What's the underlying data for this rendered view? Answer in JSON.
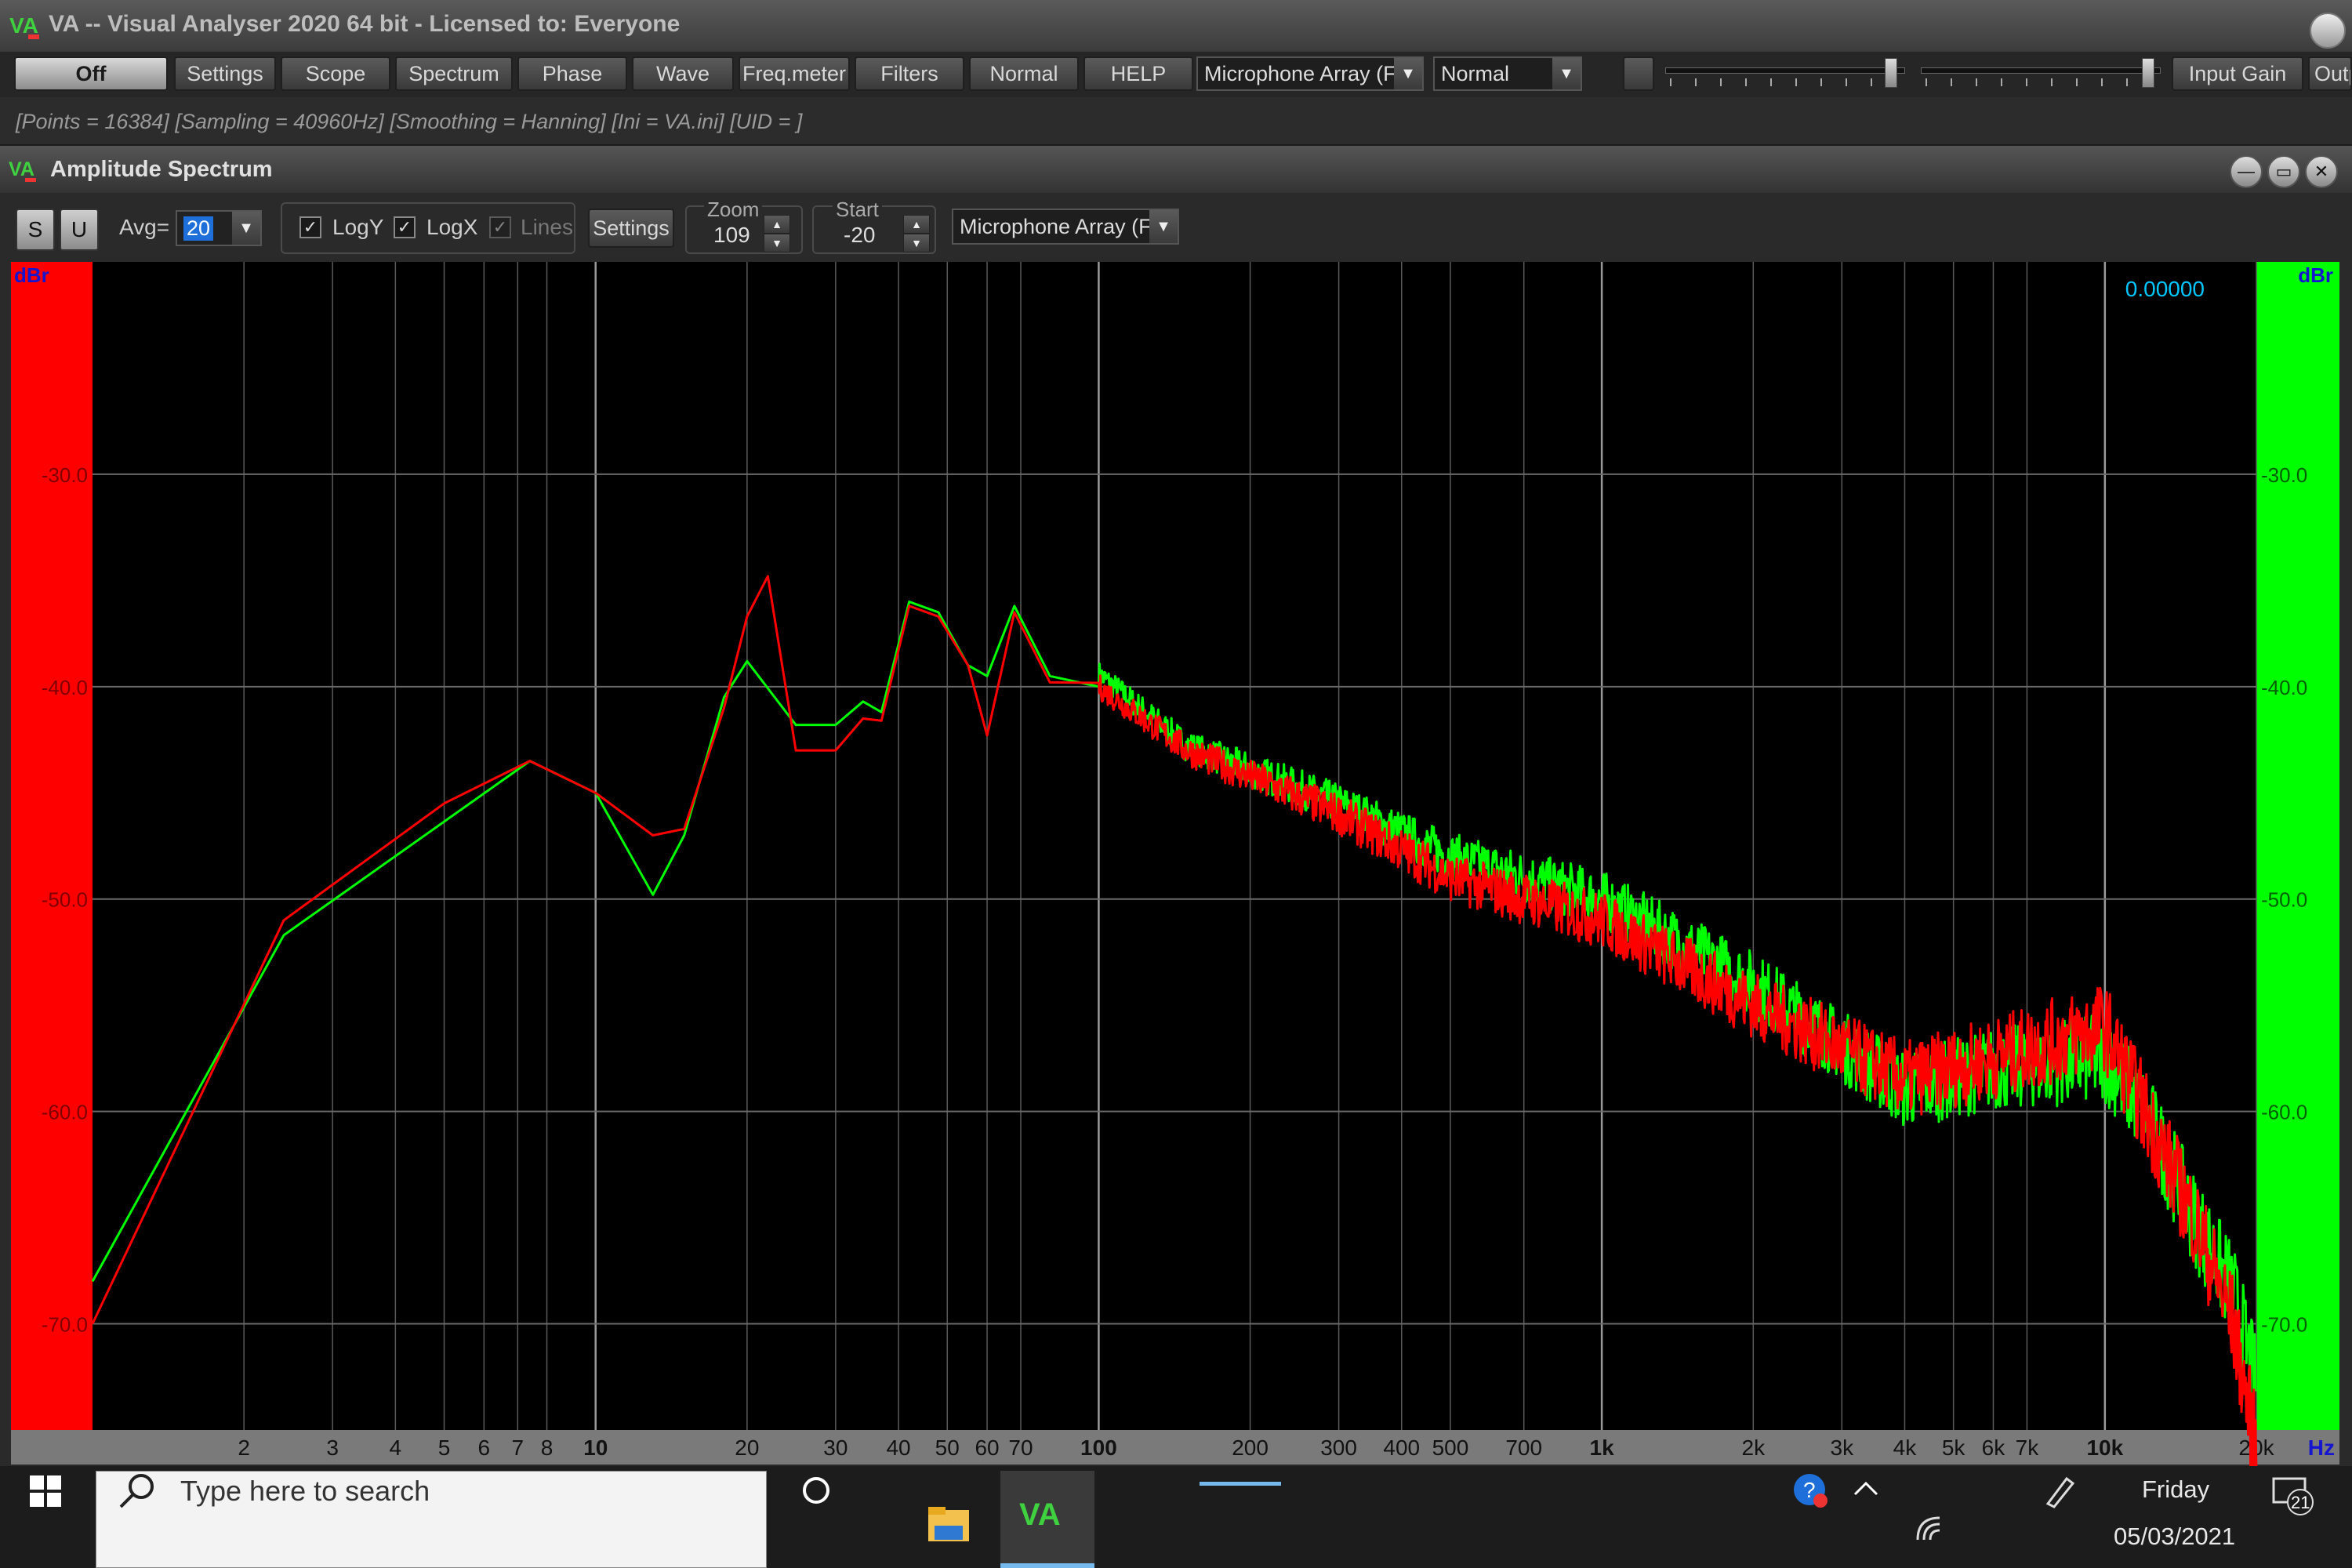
{
  "window": {
    "logo_text": "VA",
    "title": "VA -- Visual Analyser 2020 64 bit - Licensed to: Everyone"
  },
  "toolbar": {
    "buttons": [
      "Off",
      "Settings",
      "Scope",
      "Spectrum",
      "Phase",
      "Wave",
      "Freq.meter",
      "Filters",
      "Normal",
      "HELP"
    ],
    "device_select": "Microphone Array (F",
    "mode_select": "Normal",
    "input_gain_label": "Input Gain",
    "output_label": "Outp"
  },
  "status": "[Points = 16384]  [Sampling = 40960Hz]  [Smoothing = Hanning]  [Ini = VA.ini]  [UID = ]",
  "subwindow": {
    "title": "Amplitude Spectrum",
    "s_button": "S",
    "u_button": "U",
    "avg_label": "Avg=",
    "avg_value": "20",
    "logy_label": "LogY",
    "logx_label": "LogX",
    "lines_label": "Lines",
    "logy_checked": true,
    "logx_checked": true,
    "lines_checked": true,
    "settings_button": "Settings",
    "zoom_label": "Zoom",
    "zoom_value": "109",
    "start_label": "Start",
    "start_value": "-20",
    "device_select": "Microphone Array (F"
  },
  "chart_data": {
    "type": "line",
    "y_unit_left": "dBr",
    "y_unit_right": "dBr",
    "x_unit": "Hz",
    "readout": "0.00000",
    "xscale": "log",
    "xlim": [
      1,
      20000
    ],
    "ylim": [
      -75,
      -20
    ],
    "y_ticks": [
      "-30.0",
      "-40.0",
      "-50.0",
      "-60.0",
      "-70.0"
    ],
    "x_ticks": [
      "2",
      "3",
      "4",
      "5",
      "6",
      "7",
      "8",
      "10",
      "20",
      "30",
      "40",
      "50",
      "60",
      "70",
      "100",
      "200",
      "300",
      "400",
      "500",
      "700",
      "1k",
      "2k",
      "3k",
      "4k",
      "5k",
      "6k",
      "7k",
      "10k",
      "20k"
    ],
    "grid": true,
    "series": [
      {
        "color": "#00ff00",
        "x": [
          1,
          2.4,
          7.4,
          10,
          13,
          15,
          18,
          20,
          25,
          30,
          34,
          37,
          42,
          48,
          55,
          60,
          68,
          80,
          100,
          150,
          300,
          500,
          1000,
          2000,
          4000,
          6000,
          10000,
          12000,
          15000,
          18000,
          20000
        ],
        "y": [
          -68,
          -51.7,
          -43.5,
          -45,
          -49.8,
          -47,
          -40.5,
          -38.8,
          -41.8,
          -41.8,
          -40.7,
          -41.2,
          -36,
          -36.5,
          -39,
          -39.5,
          -36.2,
          -39.5,
          -39.4,
          -42.8,
          -45.5,
          -48,
          -50,
          -54,
          -59,
          -58,
          -57.5,
          -60,
          -65,
          -68.5,
          -73
        ]
      },
      {
        "color": "#ff0000",
        "x": [
          1,
          2.4,
          5,
          7.4,
          10,
          13,
          15,
          18,
          20,
          22,
          25,
          30,
          34,
          37,
          42,
          48,
          55,
          60,
          68,
          80,
          100,
          150,
          300,
          500,
          1000,
          2000,
          4000,
          6000,
          10000,
          12000,
          15000,
          18000,
          20000
        ],
        "y": [
          -70,
          -51,
          -45.5,
          -43.5,
          -45,
          -47,
          -46.7,
          -41,
          -36.7,
          -34.8,
          -43,
          -43,
          -41.5,
          -41.6,
          -36.2,
          -36.7,
          -39,
          -42.3,
          -36.5,
          -39.8,
          -40,
          -43,
          -46,
          -49,
          -51,
          -55,
          -58.5,
          -57.5,
          -56,
          -60,
          -65,
          -70,
          -76
        ]
      }
    ]
  },
  "taskbar": {
    "search_placeholder": "Type here to search",
    "app_label": "VA",
    "day": "Friday",
    "date": "05/03/2021",
    "notification_count": "21"
  }
}
